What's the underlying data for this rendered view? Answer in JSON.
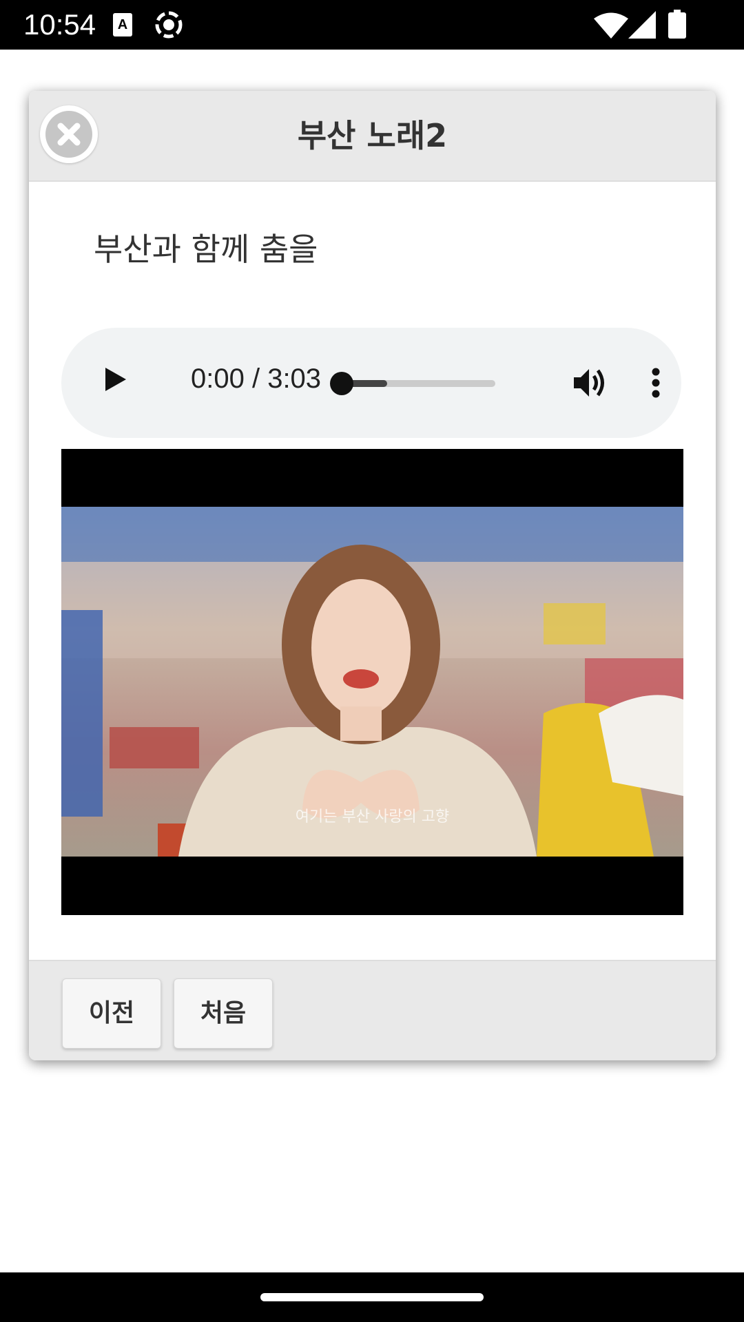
{
  "status_bar": {
    "time": "10:54",
    "icons": [
      "a-notification-icon",
      "record-icon",
      "wifi-icon",
      "signal-icon",
      "battery-icon"
    ]
  },
  "dialog": {
    "title": "부산 노래2",
    "close_icon": "close-icon",
    "subtitle": "부산과 함께 춤을",
    "audio": {
      "time": "0:00 / 3:03",
      "progress_fraction": 0,
      "buffered_fraction": 0.3,
      "icons": [
        "play-icon",
        "volume-icon",
        "more-vert-icon"
      ]
    },
    "video": {
      "caption": "여기는 부산 사랑의 고향"
    },
    "footer": {
      "prev_label": "이전",
      "first_label": "처음"
    }
  },
  "colors": {
    "header_bg": "#e9e9e9",
    "player_bg": "#f1f3f4",
    "text": "#333333"
  }
}
